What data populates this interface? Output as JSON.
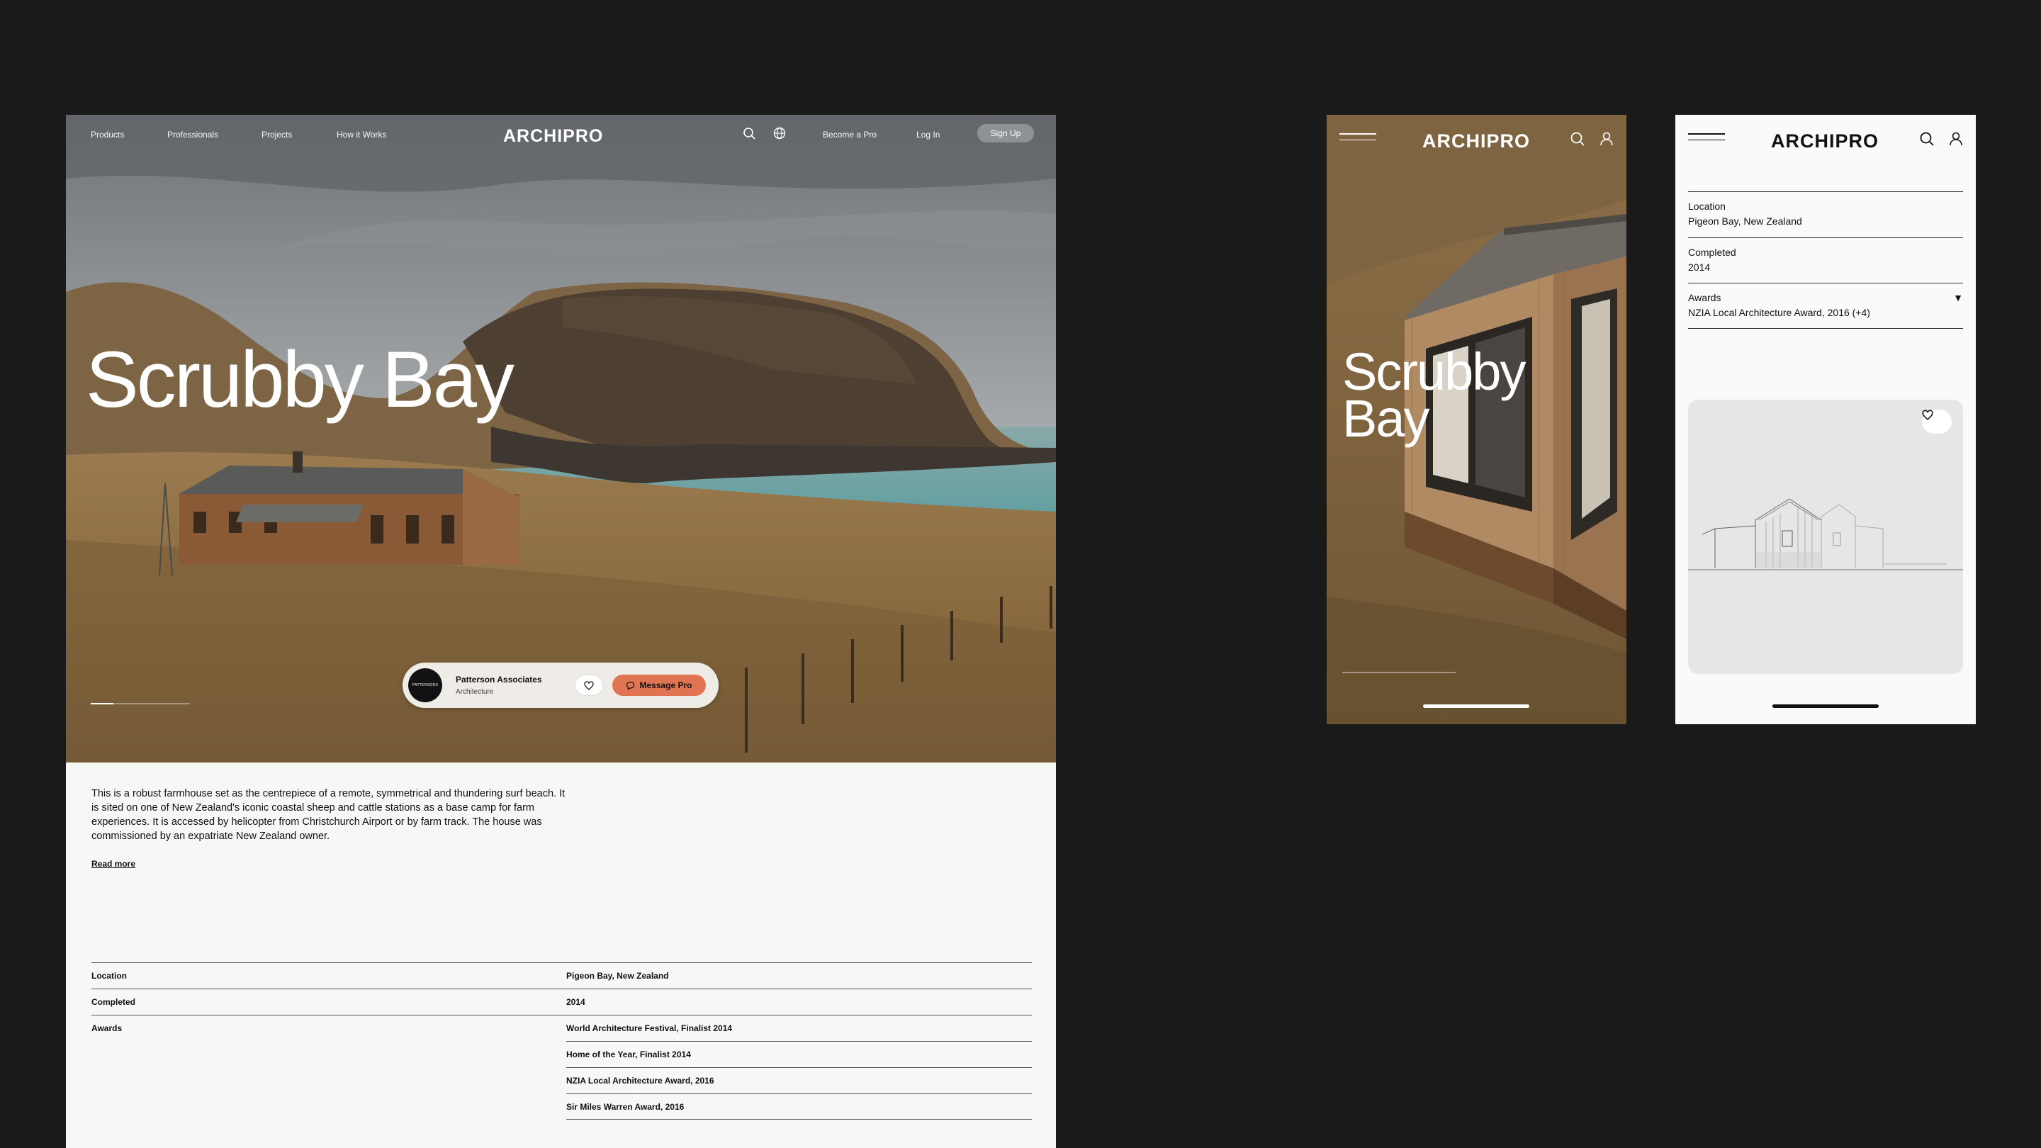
{
  "brand": {
    "logo": "ARCHIPRO"
  },
  "desktop": {
    "nav": {
      "links": [
        "Products",
        "Professionals",
        "Projects",
        "How it Works"
      ],
      "right_links": [
        "Become a Pro",
        "Log In"
      ],
      "signup": "Sign Up",
      "icons": [
        "search-icon",
        "globe-icon"
      ]
    },
    "hero": {
      "title": "Scrubby Bay"
    },
    "pro": {
      "avatar_text": "PATTERSONS",
      "name": "Patterson Associates",
      "type": "Architecture",
      "message_label": "Message Pro"
    },
    "description": "This is a robust farmhouse set as the centrepiece of a remote, symmetrical and thundering surf beach. It is sited on one of New Zealand's iconic coastal sheep and cattle stations as a base camp for farm experiences. It is accessed by helicopter from Christchurch Airport or by farm track. The house was commissioned by an expatriate New Zealand owner.",
    "read_more": "Read more",
    "info": {
      "location_label": "Location",
      "location": "Pigeon Bay, New Zealand",
      "completed_label": "Completed",
      "completed": "2014",
      "awards_label": "Awards",
      "awards": [
        "World Architecture Festival, Finalist 2014",
        "Home of the Year, Finalist 2014",
        "NZIA Local Architecture Award, 2016",
        "Sir Miles Warren Award, 2016"
      ]
    }
  },
  "mobile_hero": {
    "title_line1": "Scrubby",
    "title_line2": "Bay"
  },
  "mobile_details": {
    "rows": [
      {
        "label": "Location",
        "value": "Pigeon Bay, New Zealand"
      },
      {
        "label": "Completed",
        "value": "2014"
      },
      {
        "label": "Awards",
        "value": "NZIA Local Architecture Award, 2016 (+4)"
      }
    ]
  },
  "colors": {
    "background": "#1a1a1a",
    "accent": "#e07452",
    "page": "#f7f7f6"
  }
}
